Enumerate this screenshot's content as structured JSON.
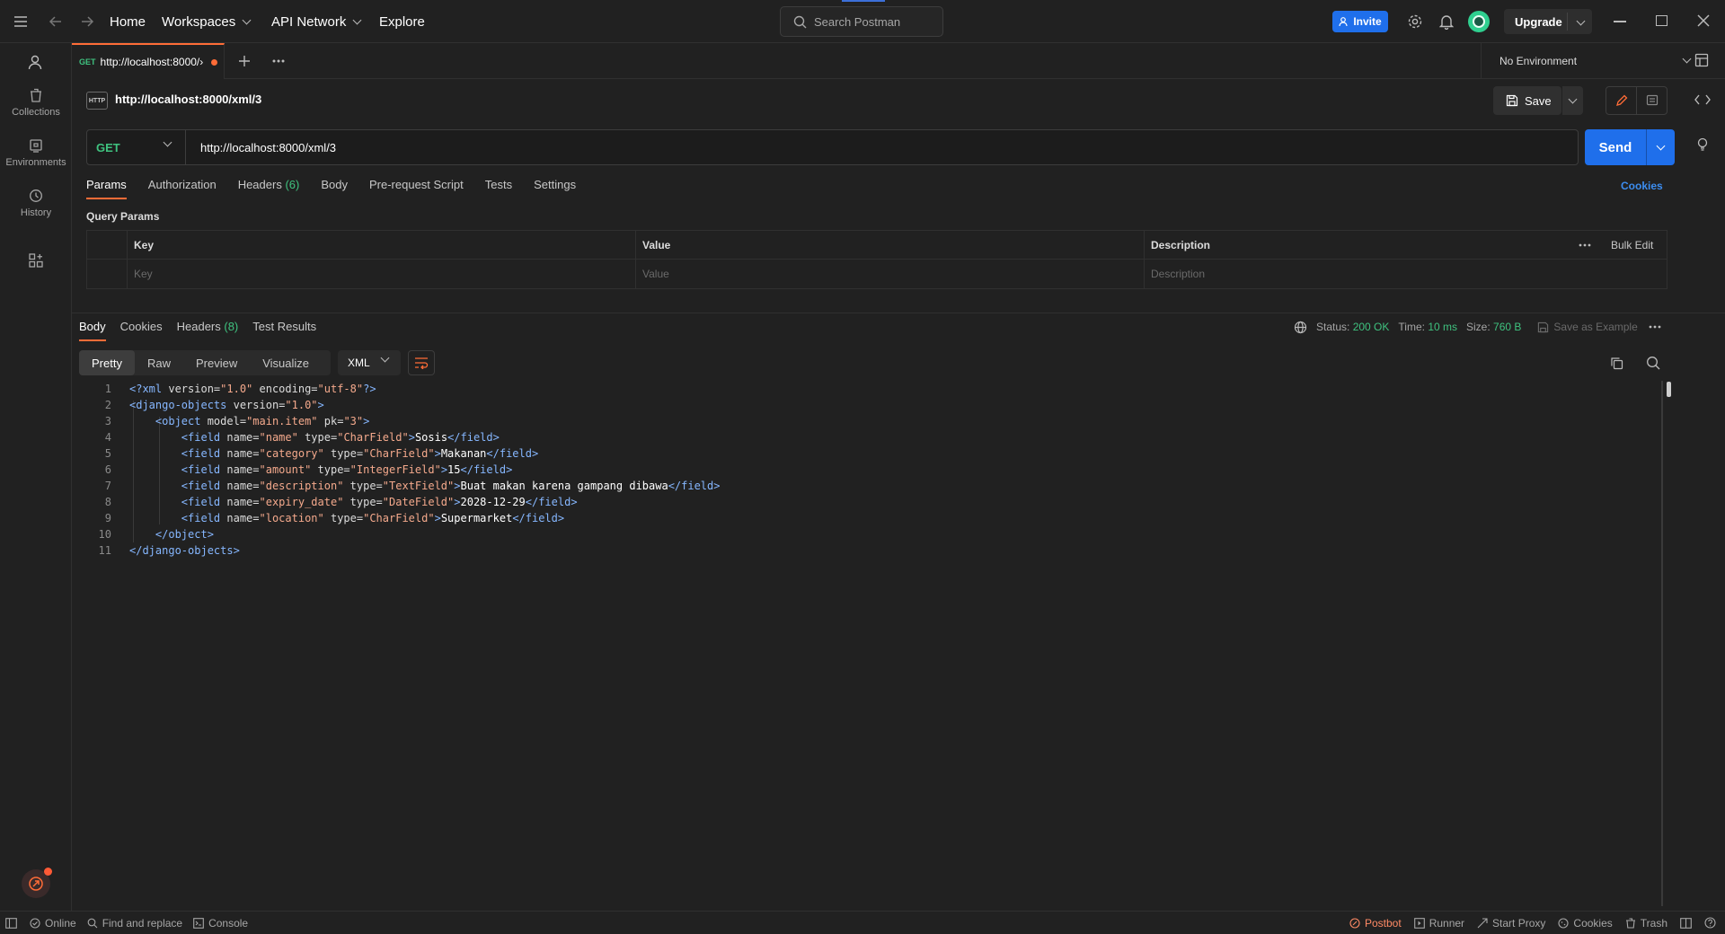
{
  "topbar": {
    "nav": [
      "Home",
      "Workspaces",
      "API Network",
      "Explore"
    ],
    "search_placeholder": "Search Postman",
    "invite_label": "Invite",
    "upgrade_label": "Upgrade",
    "brand_color": "#ff6c37",
    "accent_color": "#1f6feb"
  },
  "sidebar": {
    "items": [
      {
        "label": "Collections",
        "icon": "trash-can-icon"
      },
      {
        "label": "Environments",
        "icon": "environment-icon"
      },
      {
        "label": "History",
        "icon": "history-icon"
      }
    ]
  },
  "tab": {
    "method": "GET",
    "title": "http://localhost:8000/›"
  },
  "environment": {
    "selected": "No Environment"
  },
  "request": {
    "badge": "HTTP",
    "name": "http://localhost:8000/xml/3",
    "method": "GET",
    "url": "http://localhost:8000/xml/3",
    "save_label": "Save",
    "send_label": "Send",
    "tabs": [
      "Params",
      "Authorization",
      "Headers",
      "Body",
      "Pre-request Script",
      "Tests",
      "Settings"
    ],
    "headers_count": "(6)",
    "cookies_label": "Cookies",
    "query_params_title": "Query Params",
    "columns": [
      "Key",
      "Value",
      "Description"
    ],
    "placeholders": [
      "Key",
      "Value",
      "Description"
    ],
    "bulk_edit": "Bulk Edit"
  },
  "response": {
    "tabs": [
      "Body",
      "Cookies",
      "Headers",
      "Test Results"
    ],
    "headers_count": "(8)",
    "status_label": "Status:",
    "status_value": "200 OK",
    "time_label": "Time:",
    "time_value": "10 ms",
    "size_label": "Size:",
    "size_value": "760 B",
    "save_example": "Save as Example",
    "view_tabs": [
      "Pretty",
      "Raw",
      "Preview",
      "Visualize"
    ],
    "format": "XML"
  },
  "statusbar": {
    "left": [
      "Online",
      "Find and replace",
      "Console"
    ],
    "right": [
      "Postbot",
      "Runner",
      "Start Proxy",
      "Cookies",
      "Trash"
    ]
  }
}
